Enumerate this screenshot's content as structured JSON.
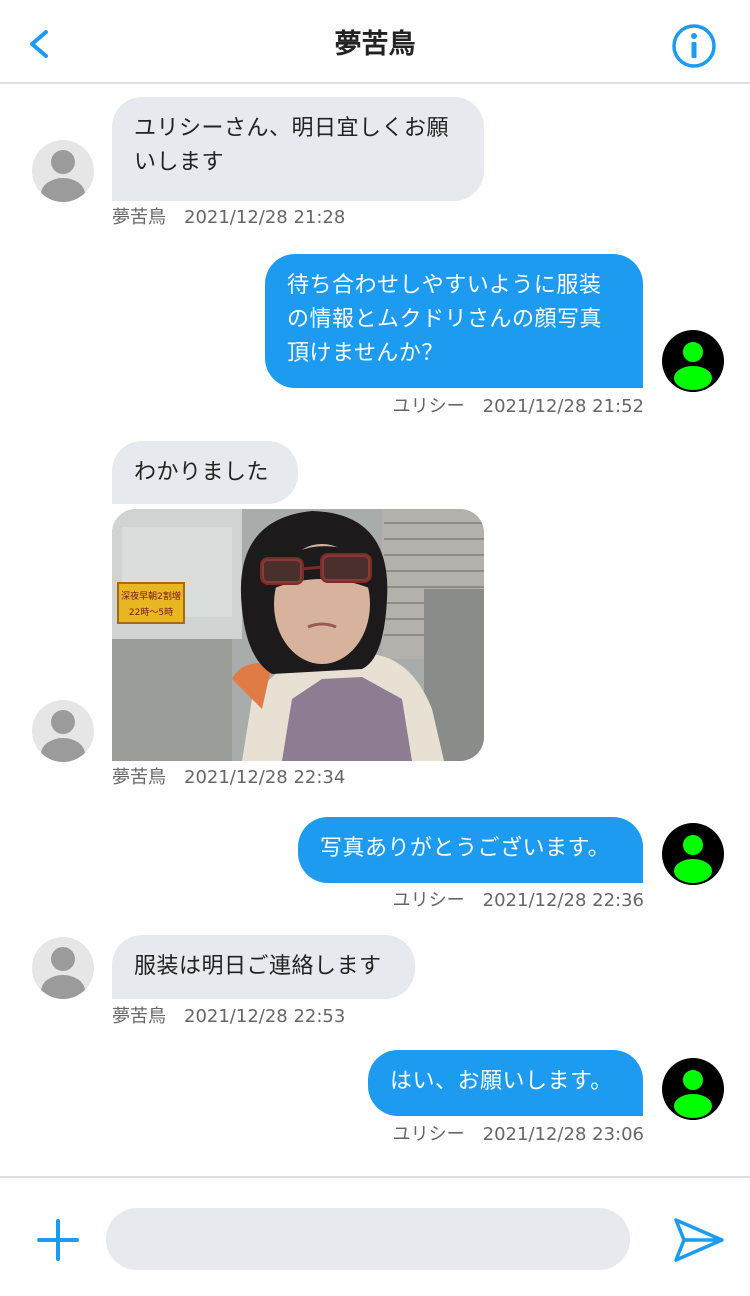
{
  "header": {
    "title": "夢苦鳥"
  },
  "messages": [
    {
      "sender": "夢苦鳥",
      "time": "2021/12/28 21:28",
      "lines": [
        "ユリシーさん、明日宜しくお願",
        "いします"
      ]
    },
    {
      "sender": "ユリシー",
      "time": "2021/12/28 21:52",
      "lines": [
        "待ち合わせしやすいように服装",
        "の情報とムクドリさんの顔写真",
        "頂けませんか？"
      ]
    },
    {
      "sender": "夢苦鳥",
      "time": "2021/12/28 22:34",
      "text": "わかりました"
    },
    {
      "sender": "ユリシー",
      "time": "2021/12/28 22:36",
      "text": "写真ありがとうございます。"
    },
    {
      "sender": "夢苦鳥",
      "time": "2021/12/28 22:53",
      "text": "服装は明日ご連絡します"
    },
    {
      "sender": "ユリシー",
      "time": "2021/12/28 23:06",
      "text": "はい、お願いします。"
    }
  ],
  "photo": {
    "sign_line1": "深夜早朝2割増",
    "sign_line2": "22時〜5時"
  },
  "composer": {
    "placeholder": ""
  },
  "colors": {
    "accent": "#1d9bf0",
    "incoming_bubble": "#e6e9ed",
    "self_avatar_fg": "#00ff00"
  }
}
